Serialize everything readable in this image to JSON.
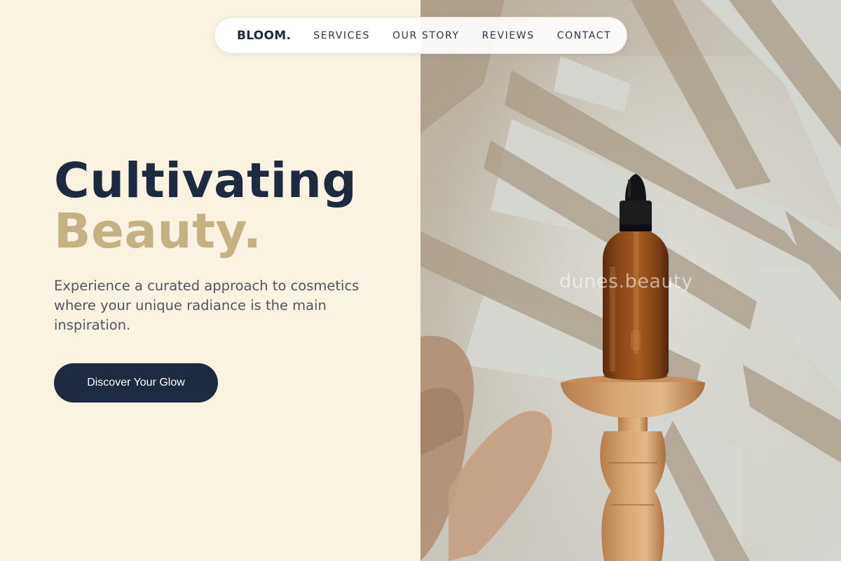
{
  "nav": {
    "brand": "BLOOM.",
    "links": [
      "SERVICES",
      "OUR STORY",
      "REVIEWS",
      "CONTACT"
    ]
  },
  "hero": {
    "headline_line1": "Cultivating",
    "headline_line2": "Beauty.",
    "subtext": "Experience a curated approach to cosmetics where your unique radiance is the main inspiration.",
    "cta_label": "Discover Your Glow"
  },
  "image": {
    "watermark": "dunes.beauty",
    "subject": "amber dropper bottle on wooden pedestal with palm leaf shadows"
  },
  "colors": {
    "background": "#faf3e1",
    "navy": "#1e2a3f",
    "gold": "#c5b283",
    "body_text": "#4e5563"
  }
}
